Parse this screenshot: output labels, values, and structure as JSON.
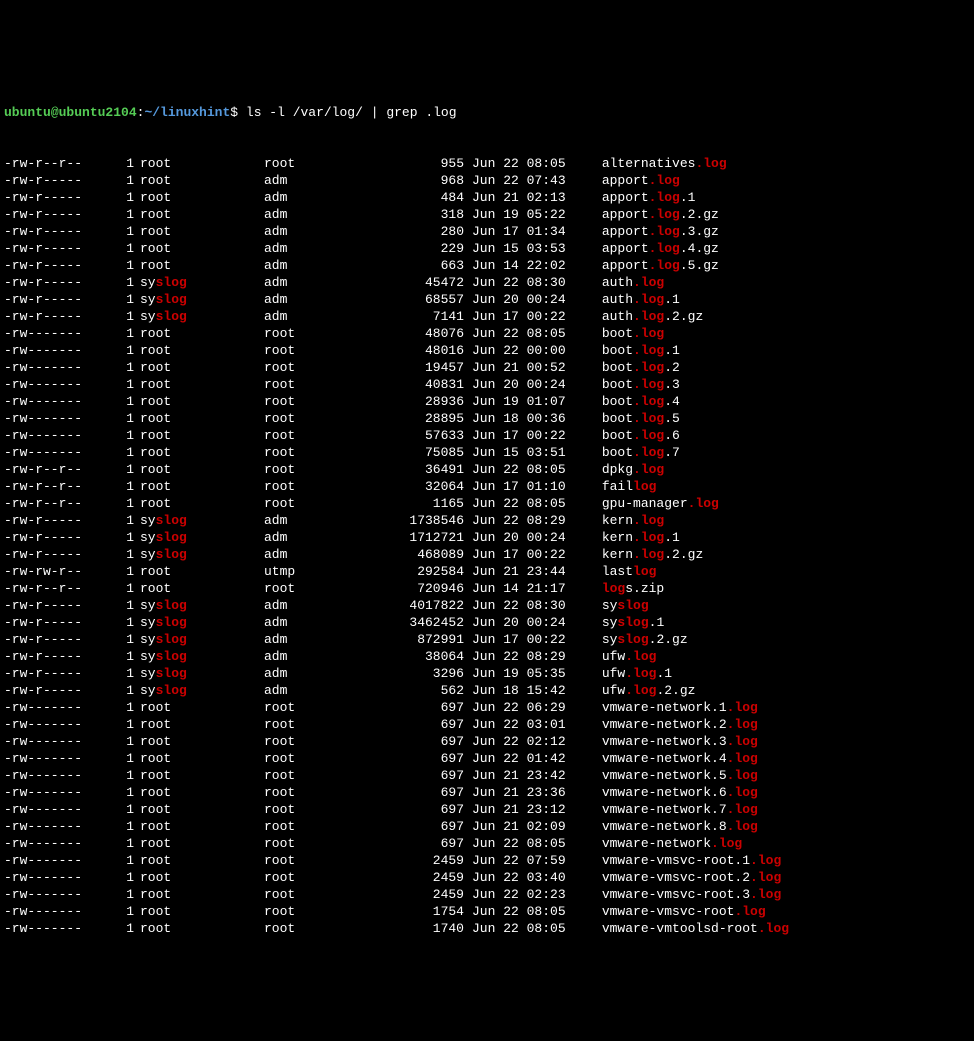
{
  "prompt": {
    "user": "ubuntu",
    "at": "@",
    "host": "ubuntu2104",
    "colon": ":",
    "path": "~/linuxhint",
    "dollar": "$ ",
    "command": "ls -l /var/log/ | grep .log"
  },
  "highlight": "log",
  "rows": [
    {
      "perms": "-rw-r--r--",
      "links": "1",
      "owner": "root",
      "group": "root",
      "size": "955",
      "date": "Jun 22 08:05",
      "fname_parts": [
        {
          "t": "alternatives",
          "c": "white"
        },
        {
          "t": ".log",
          "c": "red"
        }
      ]
    },
    {
      "perms": "-rw-r-----",
      "links": "1",
      "owner": "root",
      "group": "adm",
      "size": "968",
      "date": "Jun 22 07:43",
      "fname_parts": [
        {
          "t": "apport",
          "c": "white"
        },
        {
          "t": ".log",
          "c": "red"
        }
      ]
    },
    {
      "perms": "-rw-r-----",
      "links": "1",
      "owner": "root",
      "group": "adm",
      "size": "484",
      "date": "Jun 21 02:13",
      "fname_parts": [
        {
          "t": "apport",
          "c": "white"
        },
        {
          "t": ".log",
          "c": "red"
        },
        {
          "t": ".1",
          "c": "white"
        }
      ]
    },
    {
      "perms": "-rw-r-----",
      "links": "1",
      "owner": "root",
      "group": "adm",
      "size": "318",
      "date": "Jun 19 05:22",
      "fname_parts": [
        {
          "t": "apport",
          "c": "white"
        },
        {
          "t": ".log",
          "c": "red"
        },
        {
          "t": ".2.gz",
          "c": "white"
        }
      ]
    },
    {
      "perms": "-rw-r-----",
      "links": "1",
      "owner": "root",
      "group": "adm",
      "size": "280",
      "date": "Jun 17 01:34",
      "fname_parts": [
        {
          "t": "apport",
          "c": "white"
        },
        {
          "t": ".log",
          "c": "red"
        },
        {
          "t": ".3.gz",
          "c": "white"
        }
      ]
    },
    {
      "perms": "-rw-r-----",
      "links": "1",
      "owner": "root",
      "group": "adm",
      "size": "229",
      "date": "Jun 15 03:53",
      "fname_parts": [
        {
          "t": "apport",
          "c": "white"
        },
        {
          "t": ".log",
          "c": "red"
        },
        {
          "t": ".4.gz",
          "c": "white"
        }
      ]
    },
    {
      "perms": "-rw-r-----",
      "links": "1",
      "owner": "root",
      "group": "adm",
      "size": "663",
      "date": "Jun 14 22:02",
      "fname_parts": [
        {
          "t": "apport",
          "c": "white"
        },
        {
          "t": ".log",
          "c": "red"
        },
        {
          "t": ".5.gz",
          "c": "white"
        }
      ]
    },
    {
      "perms": "-rw-r-----",
      "links": "1",
      "owner_parts": [
        {
          "t": "sy",
          "c": "white"
        },
        {
          "t": "slog",
          "c": "red"
        }
      ],
      "group": "adm",
      "size": "45472",
      "date": "Jun 22 08:30",
      "fname_parts": [
        {
          "t": "auth",
          "c": "white"
        },
        {
          "t": ".log",
          "c": "red"
        }
      ]
    },
    {
      "perms": "-rw-r-----",
      "links": "1",
      "owner_parts": [
        {
          "t": "sy",
          "c": "white"
        },
        {
          "t": "slog",
          "c": "red"
        }
      ],
      "group": "adm",
      "size": "68557",
      "date": "Jun 20 00:24",
      "fname_parts": [
        {
          "t": "auth",
          "c": "white"
        },
        {
          "t": ".log",
          "c": "red"
        },
        {
          "t": ".1",
          "c": "white"
        }
      ]
    },
    {
      "perms": "-rw-r-----",
      "links": "1",
      "owner_parts": [
        {
          "t": "sy",
          "c": "white"
        },
        {
          "t": "slog",
          "c": "red"
        }
      ],
      "group": "adm",
      "size": "7141",
      "date": "Jun 17 00:22",
      "fname_parts": [
        {
          "t": "auth",
          "c": "white"
        },
        {
          "t": ".log",
          "c": "red"
        },
        {
          "t": ".2.gz",
          "c": "white"
        }
      ]
    },
    {
      "perms": "-rw-------",
      "links": "1",
      "owner": "root",
      "group": "root",
      "size": "48076",
      "date": "Jun 22 08:05",
      "fname_parts": [
        {
          "t": "boot",
          "c": "white"
        },
        {
          "t": ".log",
          "c": "red"
        }
      ]
    },
    {
      "perms": "-rw-------",
      "links": "1",
      "owner": "root",
      "group": "root",
      "size": "48016",
      "date": "Jun 22 00:00",
      "fname_parts": [
        {
          "t": "boot",
          "c": "white"
        },
        {
          "t": ".log",
          "c": "red"
        },
        {
          "t": ".1",
          "c": "white"
        }
      ]
    },
    {
      "perms": "-rw-------",
      "links": "1",
      "owner": "root",
      "group": "root",
      "size": "19457",
      "date": "Jun 21 00:52",
      "fname_parts": [
        {
          "t": "boot",
          "c": "white"
        },
        {
          "t": ".log",
          "c": "red"
        },
        {
          "t": ".2",
          "c": "white"
        }
      ]
    },
    {
      "perms": "-rw-------",
      "links": "1",
      "owner": "root",
      "group": "root",
      "size": "40831",
      "date": "Jun 20 00:24",
      "fname_parts": [
        {
          "t": "boot",
          "c": "white"
        },
        {
          "t": ".log",
          "c": "red"
        },
        {
          "t": ".3",
          "c": "white"
        }
      ]
    },
    {
      "perms": "-rw-------",
      "links": "1",
      "owner": "root",
      "group": "root",
      "size": "28936",
      "date": "Jun 19 01:07",
      "fname_parts": [
        {
          "t": "boot",
          "c": "white"
        },
        {
          "t": ".log",
          "c": "red"
        },
        {
          "t": ".4",
          "c": "white"
        }
      ]
    },
    {
      "perms": "-rw-------",
      "links": "1",
      "owner": "root",
      "group": "root",
      "size": "28895",
      "date": "Jun 18 00:36",
      "fname_parts": [
        {
          "t": "boot",
          "c": "white"
        },
        {
          "t": ".log",
          "c": "red"
        },
        {
          "t": ".5",
          "c": "white"
        }
      ]
    },
    {
      "perms": "-rw-------",
      "links": "1",
      "owner": "root",
      "group": "root",
      "size": "57633",
      "date": "Jun 17 00:22",
      "fname_parts": [
        {
          "t": "boot",
          "c": "white"
        },
        {
          "t": ".log",
          "c": "red"
        },
        {
          "t": ".6",
          "c": "white"
        }
      ]
    },
    {
      "perms": "-rw-------",
      "links": "1",
      "owner": "root",
      "group": "root",
      "size": "75085",
      "date": "Jun 15 03:51",
      "fname_parts": [
        {
          "t": "boot",
          "c": "white"
        },
        {
          "t": ".log",
          "c": "red"
        },
        {
          "t": ".7",
          "c": "white"
        }
      ]
    },
    {
      "perms": "-rw-r--r--",
      "links": "1",
      "owner": "root",
      "group": "root",
      "size": "36491",
      "date": "Jun 22 08:05",
      "fname_parts": [
        {
          "t": "dpkg",
          "c": "white"
        },
        {
          "t": ".log",
          "c": "red"
        }
      ]
    },
    {
      "perms": "-rw-r--r--",
      "links": "1",
      "owner": "root",
      "group": "root",
      "size": "32064",
      "date": "Jun 17 01:10",
      "fname_parts": [
        {
          "t": "fail",
          "c": "white"
        },
        {
          "t": "log",
          "c": "red"
        }
      ]
    },
    {
      "perms": "-rw-r--r--",
      "links": "1",
      "owner": "root",
      "group": "root",
      "size": "1165",
      "date": "Jun 22 08:05",
      "fname_parts": [
        {
          "t": "gpu-manager",
          "c": "white"
        },
        {
          "t": ".log",
          "c": "red"
        }
      ]
    },
    {
      "perms": "-rw-r-----",
      "links": "1",
      "owner_parts": [
        {
          "t": "sy",
          "c": "white"
        },
        {
          "t": "slog",
          "c": "red"
        }
      ],
      "group": "adm",
      "size": "1738546",
      "date": "Jun 22 08:29",
      "fname_parts": [
        {
          "t": "kern",
          "c": "white"
        },
        {
          "t": ".log",
          "c": "red"
        }
      ]
    },
    {
      "perms": "-rw-r-----",
      "links": "1",
      "owner_parts": [
        {
          "t": "sy",
          "c": "white"
        },
        {
          "t": "slog",
          "c": "red"
        }
      ],
      "group": "adm",
      "size": "1712721",
      "date": "Jun 20 00:24",
      "fname_parts": [
        {
          "t": "kern",
          "c": "white"
        },
        {
          "t": ".log",
          "c": "red"
        },
        {
          "t": ".1",
          "c": "white"
        }
      ]
    },
    {
      "perms": "-rw-r-----",
      "links": "1",
      "owner_parts": [
        {
          "t": "sy",
          "c": "white"
        },
        {
          "t": "slog",
          "c": "red"
        }
      ],
      "group": "adm",
      "size": "468089",
      "date": "Jun 17 00:22",
      "fname_parts": [
        {
          "t": "kern",
          "c": "white"
        },
        {
          "t": ".log",
          "c": "red"
        },
        {
          "t": ".2.gz",
          "c": "white"
        }
      ]
    },
    {
      "perms": "-rw-rw-r--",
      "links": "1",
      "owner": "root",
      "group": "utmp",
      "size": "292584",
      "date": "Jun 21 23:44",
      "fname_parts": [
        {
          "t": "last",
          "c": "white"
        },
        {
          "t": "log",
          "c": "red"
        }
      ]
    },
    {
      "perms": "-rw-r--r--",
      "links": "1",
      "owner": "root",
      "group": "root",
      "size": "720946",
      "date": "Jun 14 21:17",
      "fname_parts": [
        {
          "t": "log",
          "c": "red"
        },
        {
          "t": "s.zip",
          "c": "white"
        }
      ]
    },
    {
      "perms": "-rw-r-----",
      "links": "1",
      "owner_parts": [
        {
          "t": "sy",
          "c": "white"
        },
        {
          "t": "slog",
          "c": "red"
        }
      ],
      "group": "adm",
      "size": "4017822",
      "date": "Jun 22 08:30",
      "fname_parts": [
        {
          "t": "sy",
          "c": "white"
        },
        {
          "t": "slog",
          "c": "red"
        }
      ]
    },
    {
      "perms": "-rw-r-----",
      "links": "1",
      "owner_parts": [
        {
          "t": "sy",
          "c": "white"
        },
        {
          "t": "slog",
          "c": "red"
        }
      ],
      "group": "adm",
      "size": "3462452",
      "date": "Jun 20 00:24",
      "fname_parts": [
        {
          "t": "sy",
          "c": "white"
        },
        {
          "t": "slog",
          "c": "red"
        },
        {
          "t": ".1",
          "c": "white"
        }
      ]
    },
    {
      "perms": "-rw-r-----",
      "links": "1",
      "owner_parts": [
        {
          "t": "sy",
          "c": "white"
        },
        {
          "t": "slog",
          "c": "red"
        }
      ],
      "group": "adm",
      "size": "872991",
      "date": "Jun 17 00:22",
      "fname_parts": [
        {
          "t": "sy",
          "c": "white"
        },
        {
          "t": "slog",
          "c": "red"
        },
        {
          "t": ".2.gz",
          "c": "white"
        }
      ]
    },
    {
      "perms": "-rw-r-----",
      "links": "1",
      "owner_parts": [
        {
          "t": "sy",
          "c": "white"
        },
        {
          "t": "slog",
          "c": "red"
        }
      ],
      "group": "adm",
      "size": "38064",
      "date": "Jun 22 08:29",
      "fname_parts": [
        {
          "t": "ufw",
          "c": "white"
        },
        {
          "t": ".log",
          "c": "red"
        }
      ]
    },
    {
      "perms": "-rw-r-----",
      "links": "1",
      "owner_parts": [
        {
          "t": "sy",
          "c": "white"
        },
        {
          "t": "slog",
          "c": "red"
        }
      ],
      "group": "adm",
      "size": "3296",
      "date": "Jun 19 05:35",
      "fname_parts": [
        {
          "t": "ufw",
          "c": "white"
        },
        {
          "t": ".log",
          "c": "red"
        },
        {
          "t": ".1",
          "c": "white"
        }
      ]
    },
    {
      "perms": "-rw-r-----",
      "links": "1",
      "owner_parts": [
        {
          "t": "sy",
          "c": "white"
        },
        {
          "t": "slog",
          "c": "red"
        }
      ],
      "group": "adm",
      "size": "562",
      "date": "Jun 18 15:42",
      "fname_parts": [
        {
          "t": "ufw",
          "c": "white"
        },
        {
          "t": ".log",
          "c": "red"
        },
        {
          "t": ".2.gz",
          "c": "white"
        }
      ]
    },
    {
      "perms": "-rw-------",
      "links": "1",
      "owner": "root",
      "group": "root",
      "size": "697",
      "date": "Jun 22 06:29",
      "fname_parts": [
        {
          "t": "vmware-network.1",
          "c": "white"
        },
        {
          "t": ".log",
          "c": "red"
        }
      ]
    },
    {
      "perms": "-rw-------",
      "links": "1",
      "owner": "root",
      "group": "root",
      "size": "697",
      "date": "Jun 22 03:01",
      "fname_parts": [
        {
          "t": "vmware-network.2",
          "c": "white"
        },
        {
          "t": ".log",
          "c": "red"
        }
      ]
    },
    {
      "perms": "-rw-------",
      "links": "1",
      "owner": "root",
      "group": "root",
      "size": "697",
      "date": "Jun 22 02:12",
      "fname_parts": [
        {
          "t": "vmware-network.3",
          "c": "white"
        },
        {
          "t": ".log",
          "c": "red"
        }
      ]
    },
    {
      "perms": "-rw-------",
      "links": "1",
      "owner": "root",
      "group": "root",
      "size": "697",
      "date": "Jun 22 01:42",
      "fname_parts": [
        {
          "t": "vmware-network.4",
          "c": "white"
        },
        {
          "t": ".log",
          "c": "red"
        }
      ]
    },
    {
      "perms": "-rw-------",
      "links": "1",
      "owner": "root",
      "group": "root",
      "size": "697",
      "date": "Jun 21 23:42",
      "fname_parts": [
        {
          "t": "vmware-network.5",
          "c": "white"
        },
        {
          "t": ".log",
          "c": "red"
        }
      ]
    },
    {
      "perms": "-rw-------",
      "links": "1",
      "owner": "root",
      "group": "root",
      "size": "697",
      "date": "Jun 21 23:36",
      "fname_parts": [
        {
          "t": "vmware-network.6",
          "c": "white"
        },
        {
          "t": ".log",
          "c": "red"
        }
      ]
    },
    {
      "perms": "-rw-------",
      "links": "1",
      "owner": "root",
      "group": "root",
      "size": "697",
      "date": "Jun 21 23:12",
      "fname_parts": [
        {
          "t": "vmware-network.7",
          "c": "white"
        },
        {
          "t": ".log",
          "c": "red"
        }
      ]
    },
    {
      "perms": "-rw-------",
      "links": "1",
      "owner": "root",
      "group": "root",
      "size": "697",
      "date": "Jun 21 02:09",
      "fname_parts": [
        {
          "t": "vmware-network.8",
          "c": "white"
        },
        {
          "t": ".log",
          "c": "red"
        }
      ]
    },
    {
      "perms": "-rw-------",
      "links": "1",
      "owner": "root",
      "group": "root",
      "size": "697",
      "date": "Jun 22 08:05",
      "fname_parts": [
        {
          "t": "vmware-network",
          "c": "white"
        },
        {
          "t": ".log",
          "c": "red"
        }
      ]
    },
    {
      "perms": "-rw-------",
      "links": "1",
      "owner": "root",
      "group": "root",
      "size": "2459",
      "date": "Jun 22 07:59",
      "fname_parts": [
        {
          "t": "vmware-vmsvc-root.1",
          "c": "white"
        },
        {
          "t": ".log",
          "c": "red"
        }
      ]
    },
    {
      "perms": "-rw-------",
      "links": "1",
      "owner": "root",
      "group": "root",
      "size": "2459",
      "date": "Jun 22 03:40",
      "fname_parts": [
        {
          "t": "vmware-vmsvc-root.2",
          "c": "white"
        },
        {
          "t": ".log",
          "c": "red"
        }
      ]
    },
    {
      "perms": "-rw-------",
      "links": "1",
      "owner": "root",
      "group": "root",
      "size": "2459",
      "date": "Jun 22 02:23",
      "fname_parts": [
        {
          "t": "vmware-vmsvc-root.3",
          "c": "white"
        },
        {
          "t": ".log",
          "c": "red"
        }
      ]
    },
    {
      "perms": "-rw-------",
      "links": "1",
      "owner": "root",
      "group": "root",
      "size": "1754",
      "date": "Jun 22 08:05",
      "fname_parts": [
        {
          "t": "vmware-vmsvc-root",
          "c": "white"
        },
        {
          "t": ".log",
          "c": "red"
        }
      ]
    },
    {
      "perms": "-rw-------",
      "links": "1",
      "owner": "root",
      "group": "root",
      "size": "1740",
      "date": "Jun 22 08:05",
      "fname_parts": [
        {
          "t": "vmware-vmtoolsd-root",
          "c": "white"
        },
        {
          "t": ".log",
          "c": "red"
        }
      ]
    }
  ]
}
